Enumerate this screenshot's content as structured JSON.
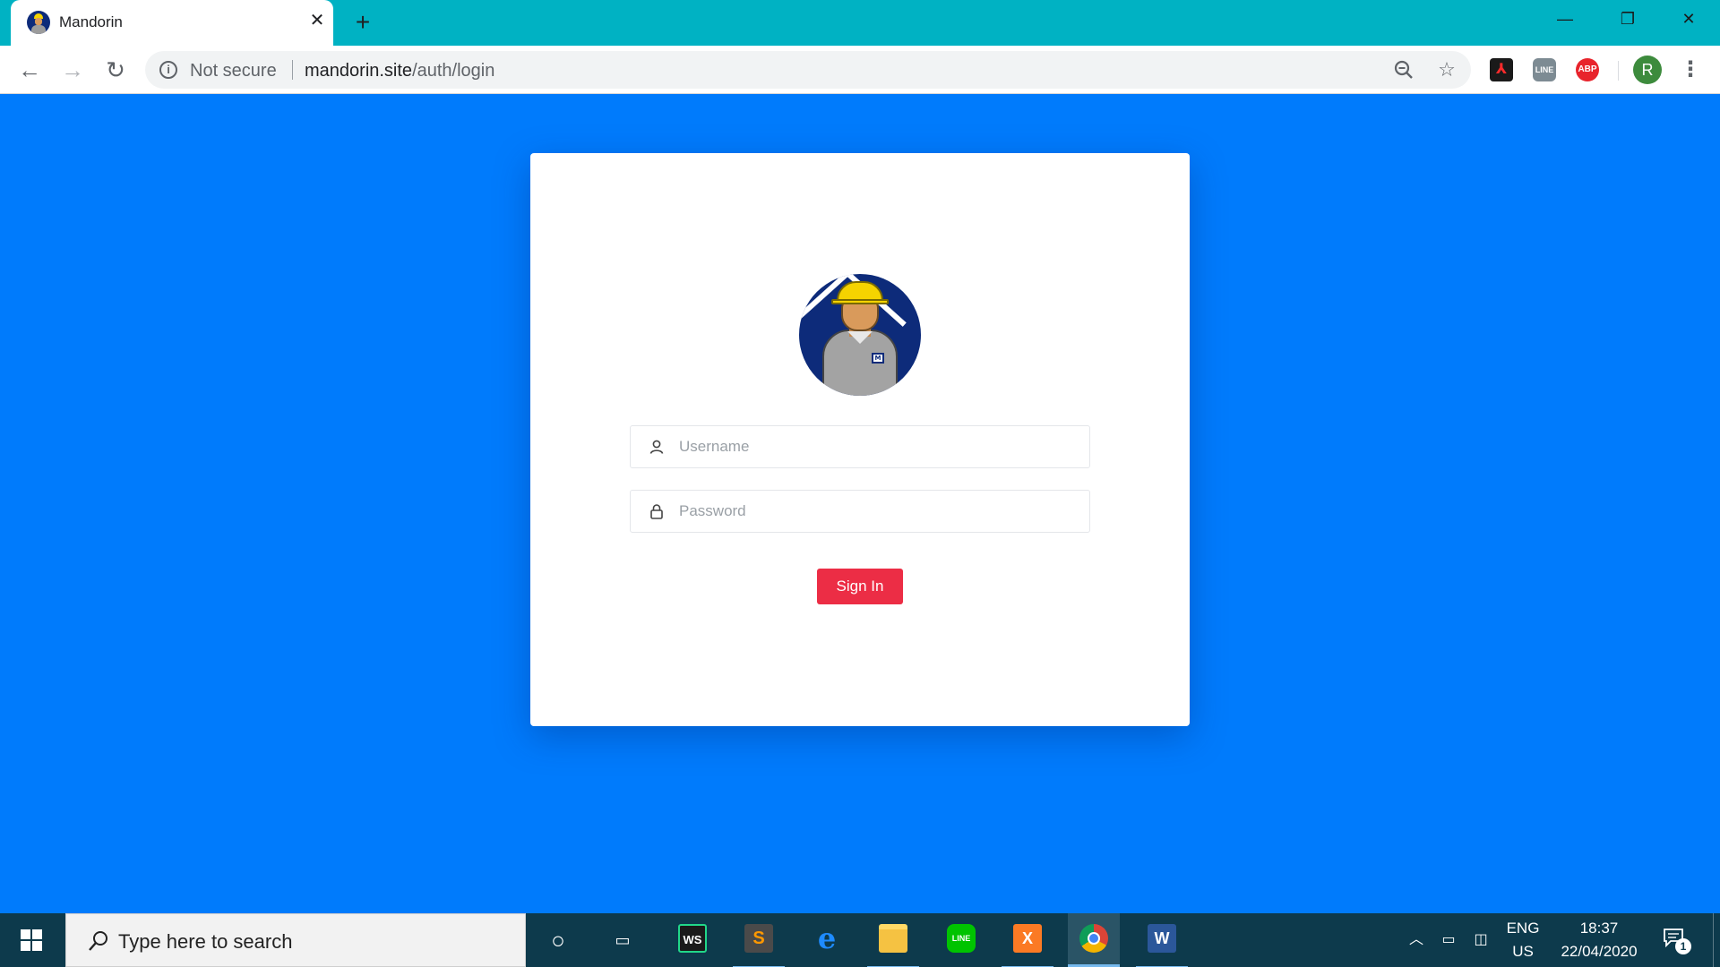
{
  "browser": {
    "tab": {
      "title": "Mandorin",
      "close_glyph": "✕"
    },
    "new_tab_glyph": "+",
    "window_controls": {
      "minimize": "—",
      "restore": "❐",
      "close": "✕"
    },
    "nav": {
      "back": "←",
      "forward": "→",
      "reload": "↻"
    },
    "omnibox": {
      "security_label": "Not secure",
      "url_host": "mandorin.site",
      "url_path": "/auth/login"
    },
    "extensions": {
      "pdf": "⅄",
      "line": "LINE",
      "abp": "ABP"
    },
    "profile_initial": "R",
    "menu_glyph": "⋮"
  },
  "login": {
    "logo_badge": "M",
    "username_placeholder": "Username",
    "password_placeholder": "Password",
    "submit_label": "Sign In"
  },
  "taskbar": {
    "search_placeholder": "Type here to search",
    "apps": [
      {
        "name": "WebStorm",
        "label": "WS",
        "color": "#1a1a1a"
      },
      {
        "name": "Sublime Text",
        "label": "S",
        "color": "#4a4a4a"
      },
      {
        "name": "Edge",
        "label": "e",
        "color": "#1e6fd0"
      },
      {
        "name": "File Explorer",
        "label": "",
        "color": "#f5c242"
      },
      {
        "name": "LINE",
        "label": "LINE",
        "color": "#00c300"
      },
      {
        "name": "XAMPP",
        "label": "X",
        "color": "#fb7a24"
      },
      {
        "name": "Chrome",
        "label": "",
        "color": "#db4437"
      },
      {
        "name": "Word",
        "label": "W",
        "color": "#2b579a"
      }
    ],
    "tray": {
      "lang_line1": "ENG",
      "lang_line2": "US",
      "time": "18:37",
      "date": "22/04/2020",
      "notification_count": "1"
    }
  },
  "colors": {
    "page_background": "#007bfc",
    "tab_strip": "#00b2c3",
    "sign_in_button": "#ec2d45",
    "taskbar": "#0d3a4c"
  }
}
